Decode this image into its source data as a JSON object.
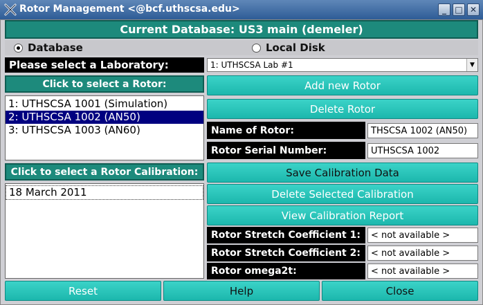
{
  "window": {
    "title": "Rotor Management <@bcf.uthscsa.edu>"
  },
  "header": {
    "current_db": "Current Database: US3 main (demeler)"
  },
  "source": {
    "database_label": "Database",
    "local_label": "Local Disk",
    "selected": "database"
  },
  "lab": {
    "prompt": "Please select a Laboratory:",
    "selected": "1: UTHSCSA Lab #1"
  },
  "rotor_list": {
    "header": "Click to select a Rotor:",
    "items": [
      "1: UTHSCSA 1001 (Simulation)",
      "2: UTHSCSA 1002 (AN50)",
      "3: UTHSCSA 1003 (AN60)"
    ],
    "selected_index": 1
  },
  "calibration_list": {
    "header": "Click to select a Rotor Calibration:",
    "items": [
      "18 March 2011"
    ]
  },
  "buttons": {
    "add_rotor": "Add new Rotor",
    "delete_rotor": "Delete Rotor",
    "save_cal": "Save Calibration Data",
    "delete_cal": "Delete Selected Calibration",
    "view_report": "View Calibration Report",
    "reset": "Reset",
    "help": "Help",
    "close": "Close"
  },
  "fields": {
    "name_label": "Name of Rotor:",
    "name_value": "THSCSA 1002 (AN50)",
    "serial_label": "Rotor Serial Number:",
    "serial_value": "UTHSCSA 1002",
    "stretch1_label": "Rotor Stretch Coefficient 1:",
    "stretch1_value": "< not available >",
    "stretch2_label": "Rotor Stretch Coefficient 2:",
    "stretch2_value": "< not available >",
    "omega_label": "Rotor omega2t:",
    "omega_value": "< not available >"
  }
}
